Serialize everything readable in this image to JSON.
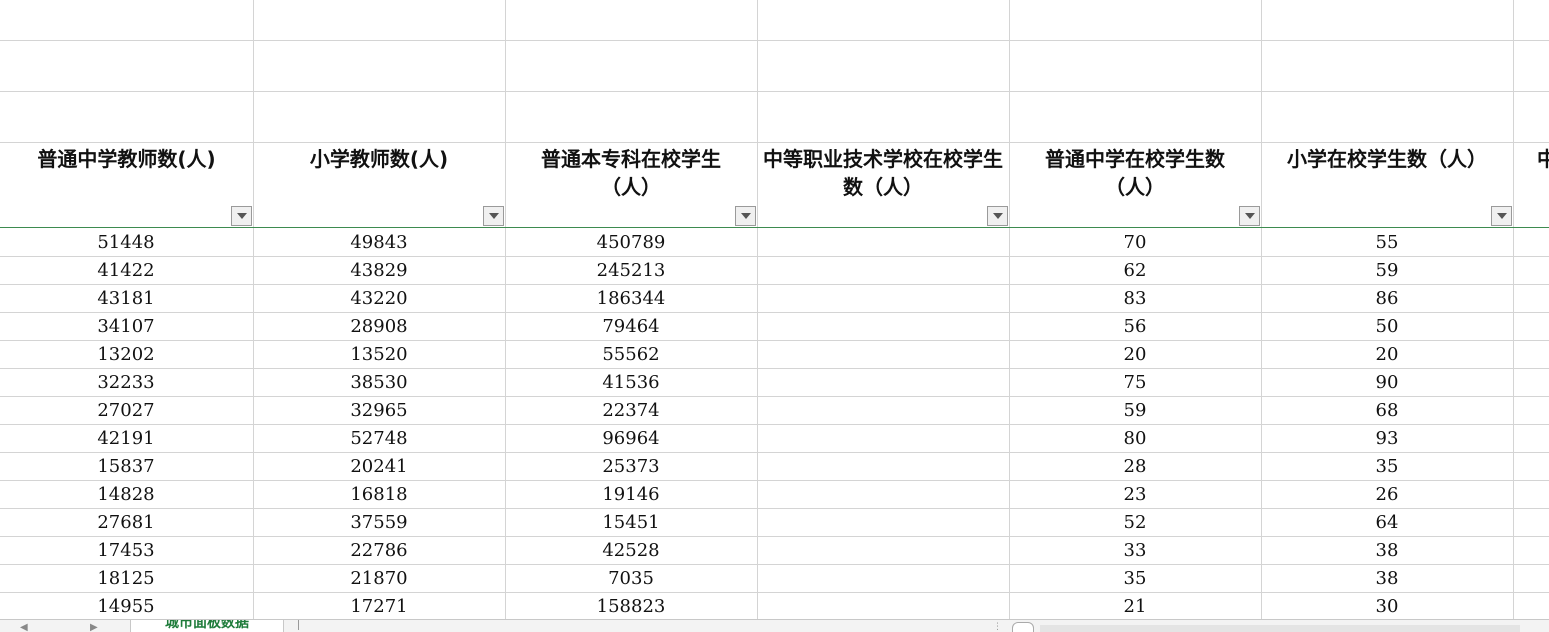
{
  "headers": [
    "普通中学教师数(人)",
    "小学教师数(人)",
    "普通本专科在校学生（人）",
    "中等职业技术学校在校学生数（人）",
    "普通中学在校学生数（人）",
    "小学在校学生数（人）",
    "中"
  ],
  "rows": [
    [
      "51448",
      "49843",
      "450789",
      "",
      "70",
      "55"
    ],
    [
      "41422",
      "43829",
      "245213",
      "",
      "62",
      "59"
    ],
    [
      "43181",
      "43220",
      "186344",
      "",
      "83",
      "86"
    ],
    [
      "34107",
      "28908",
      "79464",
      "",
      "56",
      "50"
    ],
    [
      "13202",
      "13520",
      "55562",
      "",
      "20",
      "20"
    ],
    [
      "32233",
      "38530",
      "41536",
      "",
      "75",
      "90"
    ],
    [
      "27027",
      "32965",
      "22374",
      "",
      "59",
      "68"
    ],
    [
      "42191",
      "52748",
      "96964",
      "",
      "80",
      "93"
    ],
    [
      "15837",
      "20241",
      "25373",
      "",
      "28",
      "35"
    ],
    [
      "14828",
      "16818",
      "19146",
      "",
      "23",
      "26"
    ],
    [
      "27681",
      "37559",
      "15451",
      "",
      "52",
      "64"
    ],
    [
      "17453",
      "22786",
      "42528",
      "",
      "33",
      "38"
    ],
    [
      "18125",
      "21870",
      "7035",
      "",
      "35",
      "38"
    ],
    [
      "14955",
      "17271",
      "158823",
      "",
      "21",
      "30"
    ]
  ],
  "sheet_tab": "城市面板数据",
  "colors": {
    "accent_green": "#1e7b3a",
    "gridline": "#d4d4d4",
    "header_bottom": "#3d8b4f"
  }
}
